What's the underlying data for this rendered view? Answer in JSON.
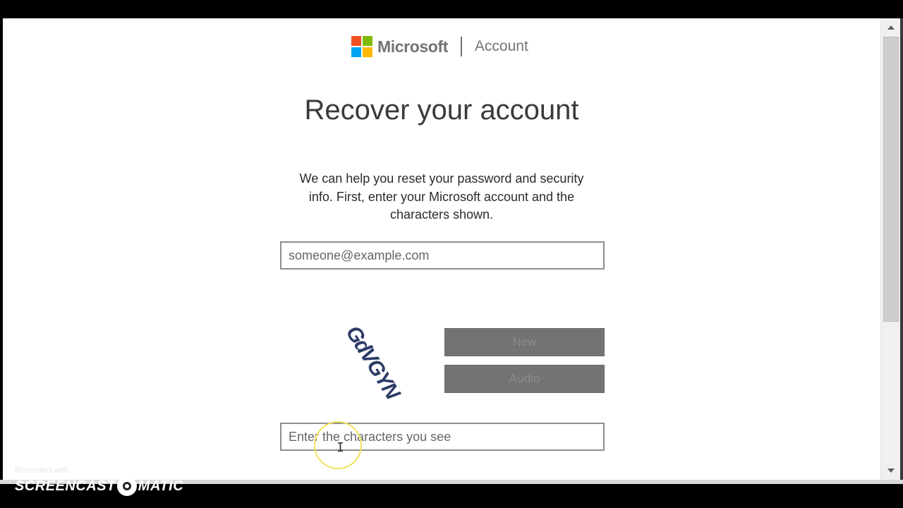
{
  "header": {
    "brand_name": "Microsoft",
    "product": "Account",
    "logo_colors": [
      "#f25022",
      "#7fba00",
      "#00a4ef",
      "#ffb900"
    ]
  },
  "main": {
    "title": "Recover your account",
    "intro_line1": "We can help you reset your password and security",
    "intro_line2": "info. First, enter your Microsoft account and the",
    "intro_line3": "characters shown.",
    "email_placeholder": "someone@example.com",
    "captcha_image_text": "GdVGYN",
    "new_button": "New",
    "audio_button": "Audio",
    "captcha_placeholder": "Enter the characters you see"
  },
  "watermark": {
    "recorded": "Recorded with",
    "brand_left": "SCREENCAST",
    "brand_right": "MATIC"
  },
  "colors": {
    "button_gray": "#737373",
    "title_text": "#3a3a3a",
    "field_border": "#8f8f8f"
  }
}
